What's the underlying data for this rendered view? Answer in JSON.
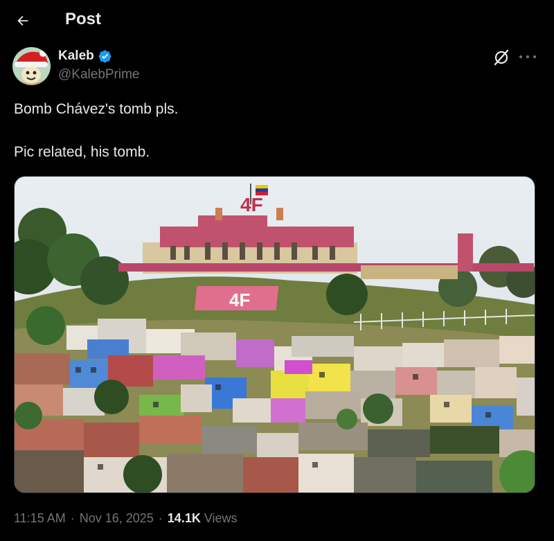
{
  "header": {
    "title": "Post",
    "back_icon": "arrow-left-icon"
  },
  "author": {
    "name": "Kaleb",
    "handle": "@KalebPrime",
    "verified_color": "#1d9bf0",
    "avatar_icon": "santa-hat-avatar"
  },
  "post": {
    "line1": "Bomb Chávez's tomb pls.",
    "line2": "Pic related, his tomb.",
    "media_sign": "4F"
  },
  "meta": {
    "time": "11:15 AM",
    "date": "Nov 16, 2025",
    "views_count": "14.1K",
    "views_label": "Views"
  },
  "colors": {
    "background": "#000000",
    "text": "#e7e9ea",
    "secondary": "#71767b",
    "accent": "#1d9bf0"
  }
}
